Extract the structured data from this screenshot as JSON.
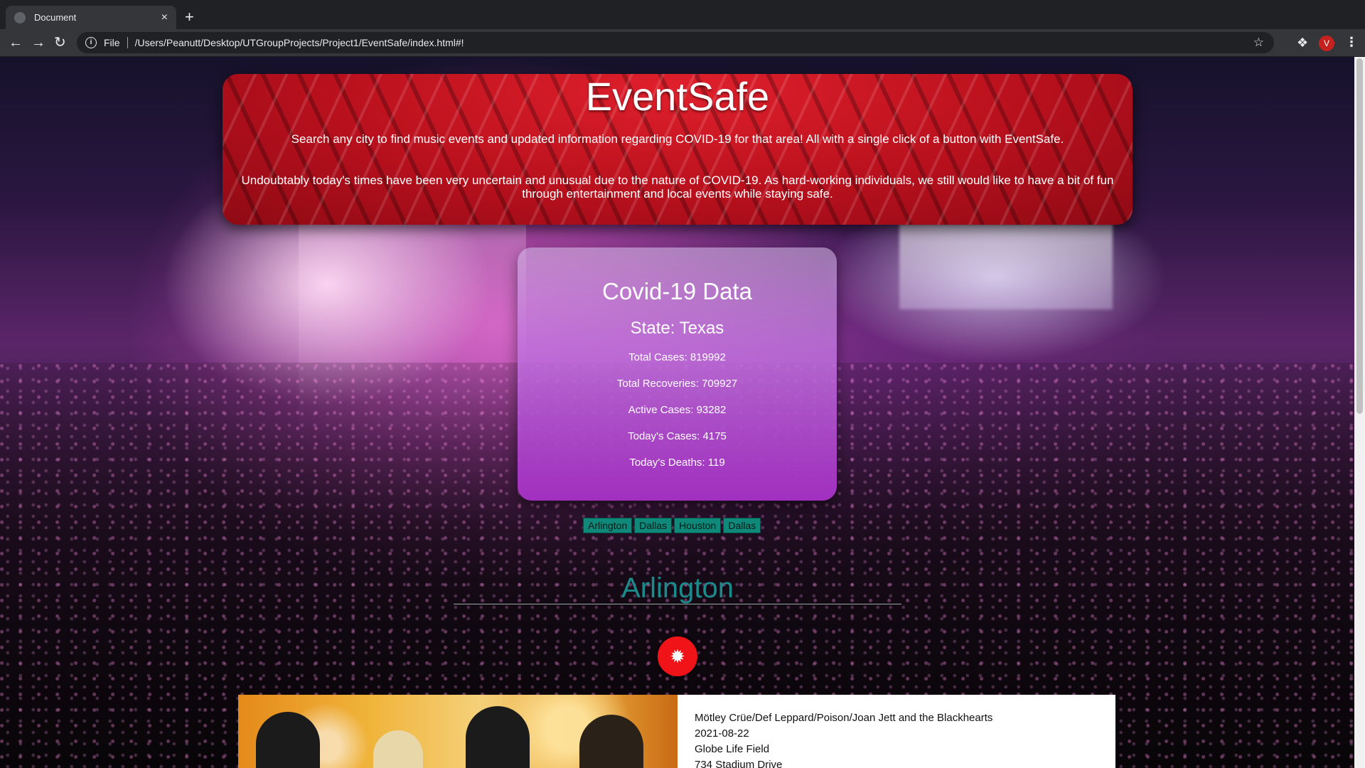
{
  "browser": {
    "tab_title": "Document",
    "new_tab": "+",
    "tab_close": "×",
    "file_chip": "File",
    "url": "/Users/Peanutt/Desktop/UTGroupProjects/Project1/EventSafe/index.html#!",
    "profile_initial": "V",
    "icons": [
      "back-icon",
      "forward-icon",
      "reload-icon",
      "info-icon",
      "star-icon",
      "extensions-icon",
      "menu-icon"
    ]
  },
  "header": {
    "title": "EventSafe",
    "tagline": "Search any city to find music events and updated information regarding COVID-19 for that area! All with a single click of a button with EventSafe.",
    "intro": "Undoubtably today's times have been very uncertain and unusual due to the nature of COVID-19. As hard-working individuals, we still would like to have a bit of fun through entertainment and local events while staying safe."
  },
  "covid": {
    "heading": "Covid-19 Data",
    "state": "State: Texas",
    "total_cases": "Total Cases: 819992",
    "total_recoveries": "Total Recoveries: 709927",
    "active_cases": "Active Cases: 93282",
    "todays_cases": "Today's Cases: 4175",
    "todays_deaths": "Today's Deaths: 119"
  },
  "city_buttons": [
    "Arlington",
    "Dallas",
    "Houston",
    "Dallas"
  ],
  "city_heading": "Arlington",
  "fab_icon": "settings-burst-icon",
  "event": {
    "name": "Mötley Crüe/Def Leppard/Poison/Joan Jett and the Blackhearts",
    "date": "2021-08-22",
    "venue": "Globe Life Field",
    "address": "734 Stadium Drive"
  },
  "colors": {
    "header_red": "#b8101d",
    "card_purple": "#a22fc0",
    "city_button": "#0f8a7a",
    "city_heading": "#1a8a8a",
    "fab_red": "#f01418"
  }
}
